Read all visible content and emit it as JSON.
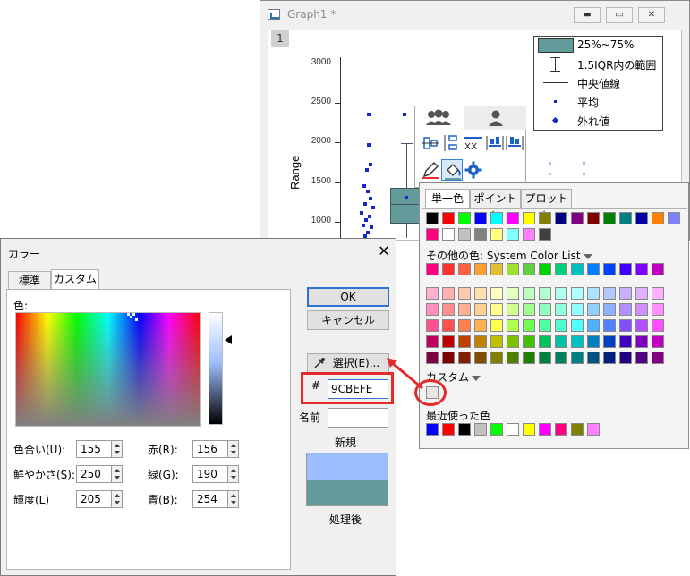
{
  "graph_window": {
    "title": "Graph1 *",
    "layer_number": "1",
    "controls": [
      "▬",
      "▭",
      "✕"
    ]
  },
  "plot": {
    "y_ticks": [
      "3000",
      "2500",
      "2000",
      "1500",
      "1000"
    ],
    "y_label": "Range"
  },
  "legend": {
    "items": [
      "25%~75%",
      "1.5IQR内の範囲",
      "中央値線",
      "平均",
      "外れ値"
    ],
    "box_color": "#639a9a"
  },
  "mini_toolbar": {
    "tabs": [
      "group-icon",
      "person-icon"
    ]
  },
  "palette": {
    "tabs": [
      "単一色",
      "ポイント毎",
      "プロット毎"
    ],
    "basic_colors": [
      "#000000",
      "#ff0000",
      "#00ff00",
      "#0000ff",
      "#00ffff",
      "#ff00ff",
      "#ffff00",
      "#808000",
      "#000080",
      "#800080",
      "#800000",
      "#008000",
      "#008080",
      "#0000a0",
      "#ff8000",
      "#8080ff",
      "#ff0080",
      "#ffffff",
      "#c0c0c0",
      "#808080",
      "#ffff80",
      "#80ffff",
      "#ff80ff",
      "#404040"
    ],
    "more_colors_label": "その他の色: System Color List",
    "system_row": [
      "#ff0080",
      "#ff3030",
      "#ff6040",
      "#ffa030",
      "#e0c030",
      "#a0e030",
      "#60d040",
      "#00d000",
      "#00d080",
      "#00c0c0",
      "#0080ff",
      "#0040ff",
      "#4000ff",
      "#8000ff",
      "#c000c0"
    ],
    "tint_rows": [
      [
        "#ffb0d0",
        "#ffb0b0",
        "#ffc8b0",
        "#ffe0b0",
        "#ffffc0",
        "#e0ffc0",
        "#c0ffc0",
        "#b0ffd0",
        "#b0ffe8",
        "#b0ffff",
        "#b0e0ff",
        "#b0c8ff",
        "#c8b0ff",
        "#e0b0ff",
        "#ffb0ff"
      ],
      [
        "#ff90c0",
        "#ff9090",
        "#ffb090",
        "#ffd090",
        "#ffff90",
        "#d0ff90",
        "#a0ff90",
        "#90ffc0",
        "#90ffe0",
        "#90ffff",
        "#90d0ff",
        "#90b0ff",
        "#b090ff",
        "#d090ff",
        "#ff90ff"
      ],
      [
        "#ff5090",
        "#ff5050",
        "#ff8050",
        "#ffb050",
        "#ffff50",
        "#b0ff50",
        "#70ff50",
        "#50ffa0",
        "#50ffd0",
        "#50ffff",
        "#50b0ff",
        "#5080ff",
        "#8050ff",
        "#b050ff",
        "#ff50ff"
      ],
      [
        "#c00060",
        "#c00000",
        "#c04000",
        "#c08000",
        "#c0c000",
        "#80c000",
        "#40c000",
        "#00c060",
        "#00c0a0",
        "#00c0c0",
        "#0080c0",
        "#0040c0",
        "#4000c0",
        "#8000c0",
        "#c000c0"
      ],
      [
        "#800040",
        "#800000",
        "#802000",
        "#805000",
        "#808000",
        "#508000",
        "#208000",
        "#008040",
        "#008060",
        "#008080",
        "#005080",
        "#002080",
        "#200080",
        "#500080",
        "#800080"
      ]
    ],
    "custom_label": "カスタム",
    "custom_color": "#e6e6e6",
    "recent_label": "最近使った色",
    "recent_colors": [
      "#0000ff",
      "#ff0000",
      "#000000",
      "#c0c0c0",
      "#00ff00",
      "#ffffff",
      "#ffff00",
      "#ff00ff",
      "#ff0080",
      "#808000",
      "#ff80ff"
    ]
  },
  "dialog": {
    "title": "カラー",
    "tabs": [
      "標準",
      "カスタム"
    ],
    "color_label": "色:",
    "hue_label": "色合い(U):",
    "sat_label": "鮮やかさ(S):",
    "lum_label": "輝度(L)",
    "red_label": "赤(R):",
    "green_label": "緑(G):",
    "blue_label": "青(B):",
    "hue": "155",
    "sat": "250",
    "lum": "205",
    "red": "156",
    "green": "190",
    "blue": "254",
    "ok": "OK",
    "cancel": "キャンセル",
    "pick": "選択(E)...",
    "hash": "#",
    "hex": "9CBEFE",
    "name_label": "名前",
    "new_label": "新規",
    "after_label": "処理後",
    "new_color": "#9cbefe",
    "old_color": "#639a9a"
  }
}
